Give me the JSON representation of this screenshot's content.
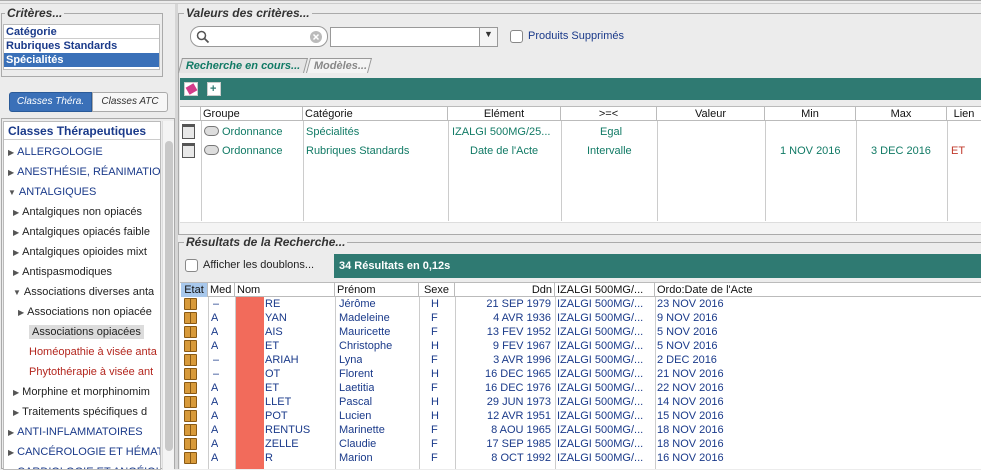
{
  "criteres_title": "Critères...",
  "categorie_header": "Catégorie",
  "categories": [
    "Rubriques Standards",
    "Spécialités"
  ],
  "tabs": [
    "Classes Théra.",
    "Classes ATC"
  ],
  "classes_header": "Classes Thérapeutiques",
  "tree": [
    {
      "label": "ALLERGOLOGIE",
      "indent": 0,
      "state": "collapsed",
      "color": "blue"
    },
    {
      "label": "ANESTHÉSIE, RÉANIMATION",
      "indent": 0,
      "state": "collapsed",
      "color": "blue"
    },
    {
      "label": "ANTALGIQUES",
      "indent": 0,
      "state": "expanded",
      "color": "blue"
    },
    {
      "label": "Antalgiques non opiacés",
      "indent": 1,
      "state": "collapsed",
      "color": "dark"
    },
    {
      "label": "Antalgiques opiacés faible",
      "indent": 1,
      "state": "collapsed",
      "color": "dark"
    },
    {
      "label": "Antalgiques opioides mixt",
      "indent": 1,
      "state": "collapsed",
      "color": "dark"
    },
    {
      "label": "Antispasmodiques",
      "indent": 1,
      "state": "collapsed",
      "color": "dark"
    },
    {
      "label": "Associations diverses anta",
      "indent": 1,
      "state": "expanded",
      "color": "dark"
    },
    {
      "label": "Associations non opiacée",
      "indent": 2,
      "state": "collapsed",
      "color": "dark"
    },
    {
      "label": "Associations opiacées",
      "indent": 2,
      "state": "selected",
      "color": "dark"
    },
    {
      "label": "Homéopathie à visée anta",
      "indent": 2,
      "state": "leaf",
      "color": "red"
    },
    {
      "label": "Phytothérapie à visée ant",
      "indent": 2,
      "state": "leaf",
      "color": "red"
    },
    {
      "label": "Morphine et morphinomim",
      "indent": 1,
      "state": "collapsed",
      "color": "dark"
    },
    {
      "label": "Traitements spécifiques d",
      "indent": 1,
      "state": "collapsed",
      "color": "dark"
    },
    {
      "label": "ANTI-INFLAMMATOIRES",
      "indent": 0,
      "state": "collapsed",
      "color": "blue"
    },
    {
      "label": "CANCÉROLOGIE ET HÉMAT",
      "indent": 0,
      "state": "collapsed",
      "color": "blue"
    },
    {
      "label": "CARDIOLOGIE ET ANGÉIOL",
      "indent": 0,
      "state": "collapsed",
      "color": "blue"
    }
  ],
  "valeurs_title": "Valeurs des critères...",
  "produits_supprimes": "Produits Supprimés",
  "search_tabs": [
    "Recherche en cours...",
    "Modèles..."
  ],
  "criteria_columns": [
    "Groupe",
    "Catégorie",
    "Elément",
    ">=<",
    "Valeur",
    "Min",
    "Max",
    "Lien"
  ],
  "criteria_rows": [
    {
      "groupe": "Ordonnance",
      "categorie": "Spécialités",
      "element": "IZALGI 500MG/25...",
      "op": "Egal",
      "valeur": "",
      "min": "",
      "max": "",
      "lien": ""
    },
    {
      "groupe": "Ordonnance",
      "categorie": "Rubriques Standards",
      "element": "Date de l'Acte",
      "op": "Intervalle",
      "valeur": "",
      "min": "1 NOV 2016",
      "max": "3 DEC 2016",
      "lien": "ET"
    }
  ],
  "resultats_title": "Résultats de la Recherche...",
  "afficher_doublons": "Afficher les doublons...",
  "result_count": "34 Résultats en 0,12s",
  "result_columns": [
    "Etat",
    "Med",
    "Nom",
    "Prénom",
    "Sexe",
    "Ddn",
    "IZALGI 500MG/...",
    "Ordo:Date de l'Acte"
  ],
  "results": [
    {
      "med": "–",
      "nom": "RE",
      "prenom": "Jérôme",
      "sexe": "H",
      "ddn": "21 SEP 1979",
      "izalgi": "IZALGI 500MG/...",
      "ordo": "23 NOV 2016"
    },
    {
      "med": "A",
      "nom": "YAN",
      "prenom": "Madeleine",
      "sexe": "F",
      "ddn": "4 AVR 1936",
      "izalgi": "IZALGI 500MG/...",
      "ordo": "9 NOV 2016"
    },
    {
      "med": "A",
      "nom": "AIS",
      "prenom": "Mauricette",
      "sexe": "F",
      "ddn": "13 FEV 1952",
      "izalgi": "IZALGI 500MG/...",
      "ordo": "5 NOV 2016"
    },
    {
      "med": "A",
      "nom": "ET",
      "prenom": "Christophe",
      "sexe": "H",
      "ddn": "9 FEV 1967",
      "izalgi": "IZALGI 500MG/...",
      "ordo": "5 NOV 2016"
    },
    {
      "med": "–",
      "nom": "ARIAH",
      "prenom": "Lyna",
      "sexe": "F",
      "ddn": "3 AVR 1996",
      "izalgi": "IZALGI 500MG/...",
      "ordo": "2 DEC 2016"
    },
    {
      "med": "–",
      "nom": "OT",
      "prenom": "Florent",
      "sexe": "H",
      "ddn": "16 DEC 1965",
      "izalgi": "IZALGI 500MG/...",
      "ordo": "21 NOV 2016"
    },
    {
      "med": "A",
      "nom": "ET",
      "prenom": "Laetitia",
      "sexe": "F",
      "ddn": "16 DEC 1976",
      "izalgi": "IZALGI 500MG/...",
      "ordo": "22 NOV 2016"
    },
    {
      "med": "A",
      "nom": "LLET",
      "prenom": "Pascal",
      "sexe": "H",
      "ddn": "29 JUN 1973",
      "izalgi": "IZALGI 500MG/...",
      "ordo": "14 NOV 2016"
    },
    {
      "med": "A",
      "nom": "POT",
      "prenom": "Lucien",
      "sexe": "H",
      "ddn": "12 AVR 1951",
      "izalgi": "IZALGI 500MG/...",
      "ordo": "15 NOV 2016"
    },
    {
      "med": "A",
      "nom": "RENTUS",
      "prenom": "Marinette",
      "sexe": "F",
      "ddn": "8 AOU 1965",
      "izalgi": "IZALGI 500MG/...",
      "ordo": "18 NOV 2016"
    },
    {
      "med": "A",
      "nom": "ZELLE",
      "prenom": "Claudie",
      "sexe": "F",
      "ddn": "17 SEP 1985",
      "izalgi": "IZALGI 500MG/...",
      "ordo": "18 NOV 2016"
    },
    {
      "med": "A",
      "nom": "R",
      "prenom": "Marion",
      "sexe": "F",
      "ddn": "8 OCT 1992",
      "izalgi": "IZALGI 500MG/...",
      "ordo": "16 NOV 2016"
    }
  ],
  "colors": {
    "teal_bar": "#2f7a72",
    "selection": "#3a70b8",
    "redaction": "#f26b5b"
  }
}
